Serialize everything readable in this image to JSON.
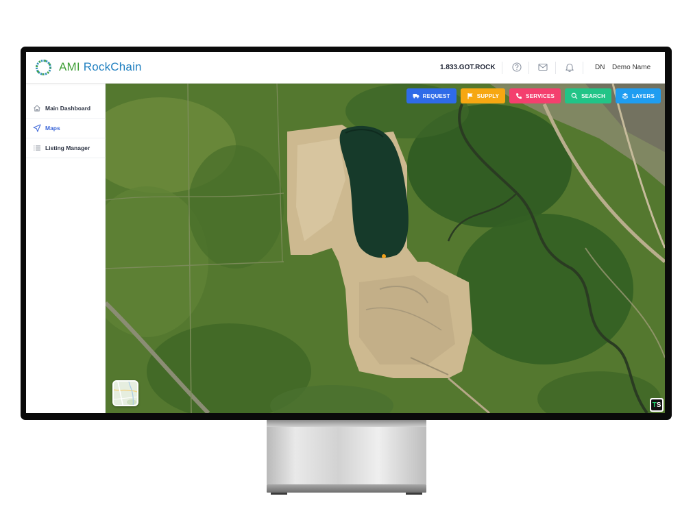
{
  "header": {
    "brand_part1": "AMI",
    "brand_part2": "RockChain",
    "phone": "1.833.GOT.ROCK",
    "user_initials": "DN",
    "user_name": "Demo Name",
    "icons": [
      "help-circle-icon",
      "mail-icon",
      "bell-icon"
    ]
  },
  "sidebar": {
    "items": [
      {
        "label": "Main Dashboard",
        "icon": "home-icon",
        "active": false
      },
      {
        "label": "Maps",
        "icon": "navigation-arrow-icon",
        "active": true
      },
      {
        "label": "Listing Manager",
        "icon": "list-icon",
        "active": false
      }
    ]
  },
  "map": {
    "buttons": [
      {
        "label": "REQUEST",
        "icon": "truck-icon",
        "color": "#2f6be8"
      },
      {
        "label": "SUPPLY",
        "icon": "flag-icon",
        "color": "#f6a712"
      },
      {
        "label": "SERVICES",
        "icon": "phone-icon",
        "color": "#f43f6e"
      },
      {
        "label": "SEARCH",
        "icon": "search-icon",
        "color": "#22c487"
      },
      {
        "label": "LAYERS",
        "icon": "layers-icon",
        "color": "#1f9df1"
      }
    ],
    "badge": {
      "t": "T",
      "s": "S"
    }
  },
  "colors": {
    "brand_green": "#3f9e36",
    "brand_blue": "#1f7fc0",
    "active_nav": "#3b66d8"
  }
}
